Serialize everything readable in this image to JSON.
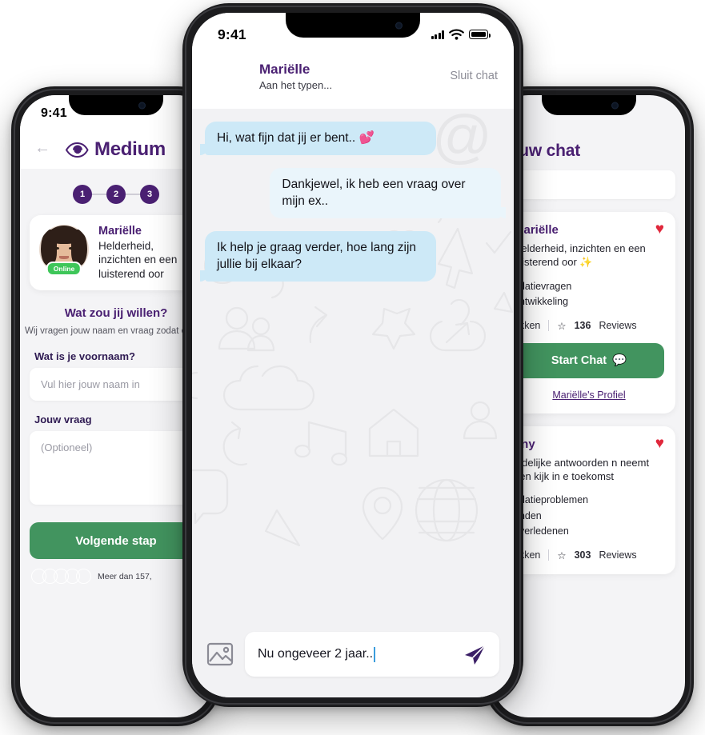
{
  "left_phone": {
    "status_bar": {
      "time": "9:41"
    },
    "header": {
      "back_icon": "back-arrow-icon",
      "eye_icon": "eye-icon",
      "title": "Medium"
    },
    "steps": [
      {
        "label": "1",
        "active": true
      },
      {
        "label": "2",
        "active": true
      },
      {
        "label": "3",
        "active": true
      }
    ],
    "profile_card": {
      "name": "Mariëlle",
      "status_badge": "Online",
      "description": "Helderheid, inzichten en een luisterend oor"
    },
    "section": {
      "title": "Wat zou jij willen?",
      "subtitle": "Wij vragen jouw naam en vraag zodat ervoor dat het gesprek soepel"
    },
    "form": {
      "name_label": "Wat is je voornaam?",
      "name_placeholder": "Vul hier jouw naam in",
      "question_label": "Jouw vraag",
      "question_placeholder": "(Optioneel)"
    },
    "primary_button": "Volgende stap",
    "social_proof": "Meer dan 157,"
  },
  "center_phone": {
    "status_bar": {
      "time": "9:41"
    },
    "header": {
      "name": "Mariëlle",
      "typing_status": "Aan het typen...",
      "close_label": "Sluit chat"
    },
    "messages": [
      {
        "side": "in",
        "text": "Hi, wat fijn dat jij er bent.. 💕"
      },
      {
        "side": "out",
        "text": "Dankjewel, ik heb een vraag over mijn ex.."
      },
      {
        "side": "in",
        "text": "Ik help je graag verder, hoe lang zijn jullie bij elkaar?"
      }
    ],
    "composer": {
      "image_icon": "image-icon",
      "value": "Nu ongeveer 2 jaar..",
      "send_icon": "send-icon"
    }
  },
  "right_phone": {
    "title": "jouw chat",
    "search_placeholder": "",
    "cards": [
      {
        "name": "Mariëlle",
        "favorite_icon": "heart-icon",
        "description": "Helderheid, inzichten en een luisterend oor ✨",
        "tags": [
          "relatievragen",
          "ontwikkeling"
        ],
        "availability": "ekken",
        "rating_icon": "star-icon",
        "reviews_count": "136",
        "reviews_label": "Reviews",
        "button_label": "Start Chat",
        "button_icon": "chat-bubble-icon",
        "profile_link": "Mariëlle's Profiel"
      },
      {
        "name": "ony",
        "favorite_icon": "heart-icon",
        "description": "uidelijke antwoorden n neemt een kijk in e toekomst",
        "tags": [
          "relatieproblemen",
          "enden",
          "overledenen"
        ],
        "availability": "ekken",
        "rating_icon": "star-icon",
        "reviews_count": "303",
        "reviews_label": "Reviews"
      }
    ]
  },
  "colors": {
    "purple": "#4a2072",
    "green": "#42945f",
    "bubble_in": "#cde9f7",
    "bubble_out": "#eaf5fb",
    "heart_red": "#e0283c",
    "online_green": "#3ec659",
    "screen_bg": "#f2f2f4"
  }
}
